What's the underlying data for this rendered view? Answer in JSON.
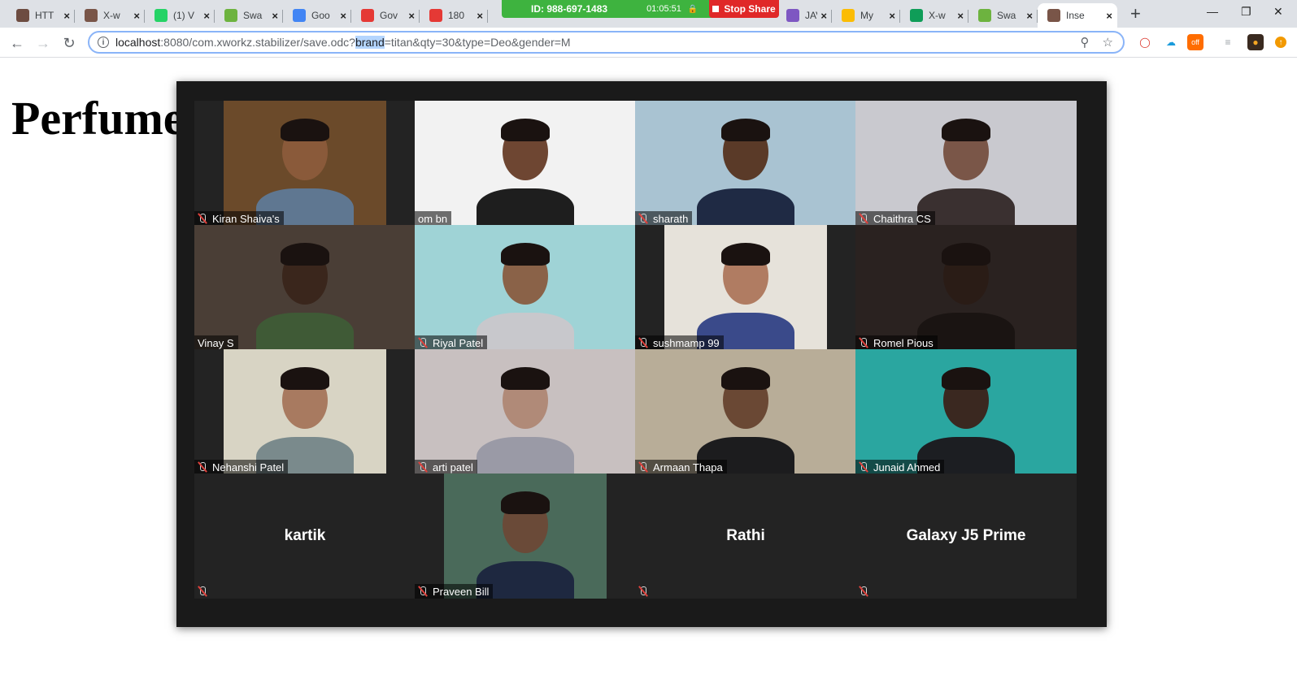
{
  "tabs": [
    {
      "title": "HTT",
      "color": "#6d4c41",
      "active": false
    },
    {
      "title": "X-w",
      "color": "#795548",
      "active": false
    },
    {
      "title": "(1) V",
      "color": "#25d366",
      "active": false
    },
    {
      "title": "Swa",
      "color": "#6db33f",
      "active": false
    },
    {
      "title": "Goo",
      "color": "#4285f4",
      "active": false
    },
    {
      "title": "Gov",
      "color": "#e53935",
      "active": false
    },
    {
      "title": "180",
      "color": "#e53935",
      "active": false
    },
    {
      "title": "JAVA",
      "color": "#7e57c2",
      "active": false
    },
    {
      "title": "My",
      "color": "#fbbc04",
      "active": false
    },
    {
      "title": "X-w",
      "color": "#0f9d58",
      "active": false
    },
    {
      "title": "Swa",
      "color": "#6db33f",
      "active": false
    },
    {
      "title": "Inse",
      "color": "#795548",
      "active": true
    }
  ],
  "share_bar": {
    "meeting_id": "ID: 988-697-1483",
    "timer": "01:05:51",
    "stop_label": "Stop Share"
  },
  "address_bar": {
    "host": "localhost",
    "path_before": ":8080/com.xworkz.stabilizer/save.odc?",
    "selected": "brand",
    "path_after": "=titan&qty=30&type=Deo&gender=M"
  },
  "page": {
    "heading": "Perfume"
  },
  "participants": [
    {
      "name": "Kiran Shaiva's",
      "video": true,
      "muted": true,
      "bg": "#6b4a2a",
      "skin": "#8a5a3a",
      "shirt": "#5f7791"
    },
    {
      "name": "om bn",
      "video": true,
      "muted": false,
      "bg": "#f2f2f2",
      "skin": "#6e4632",
      "shirt": "#1e1e1e"
    },
    {
      "name": "sharath",
      "video": true,
      "muted": true,
      "bg": "#a9c3d2",
      "skin": "#5a3a28",
      "shirt": "#1f2a44"
    },
    {
      "name": "Chaithra CS",
      "video": true,
      "muted": true,
      "bg": "#c9c9cf",
      "skin": "#7a5648",
      "shirt": "#3a3030"
    },
    {
      "name": "Vinay S",
      "video": true,
      "muted": false,
      "bg": "#4a3e36",
      "skin": "#3a261c",
      "shirt": "#3f5a36"
    },
    {
      "name": "Riyal Patel",
      "video": true,
      "muted": true,
      "bg": "#9fd3d6",
      "skin": "#8a6248",
      "shirt": "#c8c8cc"
    },
    {
      "name": "sushmamp 99",
      "video": true,
      "muted": true,
      "bg": "#e6e2da",
      "skin": "#b07c62",
      "shirt": "#3a4a8a"
    },
    {
      "name": "Romel Pious",
      "video": true,
      "muted": true,
      "bg": "#2a2220",
      "skin": "#2a1c16",
      "shirt": "#1a1412"
    },
    {
      "name": "Nehanshi Patel",
      "video": true,
      "muted": true,
      "bg": "#d8d4c4",
      "skin": "#a87a60",
      "shirt": "#7a8a8c"
    },
    {
      "name": "arti patel",
      "video": true,
      "muted": true,
      "bg": "#c8c0c0",
      "skin": "#b08a78",
      "shirt": "#9a9aa6"
    },
    {
      "name": "Armaan Thapa",
      "video": true,
      "muted": true,
      "bg": "#b8ad98",
      "skin": "#6a4834",
      "shirt": "#1c1c1e"
    },
    {
      "name": "Junaid Ahmed",
      "video": true,
      "muted": true,
      "bg": "#2aa6a0",
      "skin": "#3a2820",
      "shirt": "#1c1e22"
    },
    {
      "name": "kartik",
      "video": false,
      "muted": true
    },
    {
      "name": "Praveen Bill",
      "video": true,
      "muted": true,
      "bg": "#4a6a5a",
      "skin": "#6a4a38",
      "shirt": "#1e2840"
    },
    {
      "name": "Rathi",
      "video": false,
      "muted": true
    },
    {
      "name": "Galaxy J5 Prime",
      "video": false,
      "muted": true
    }
  ],
  "colors": {
    "active_speaker_border": "#f5e07a",
    "share_green": "#3eb33f",
    "stop_red": "#e02828"
  }
}
